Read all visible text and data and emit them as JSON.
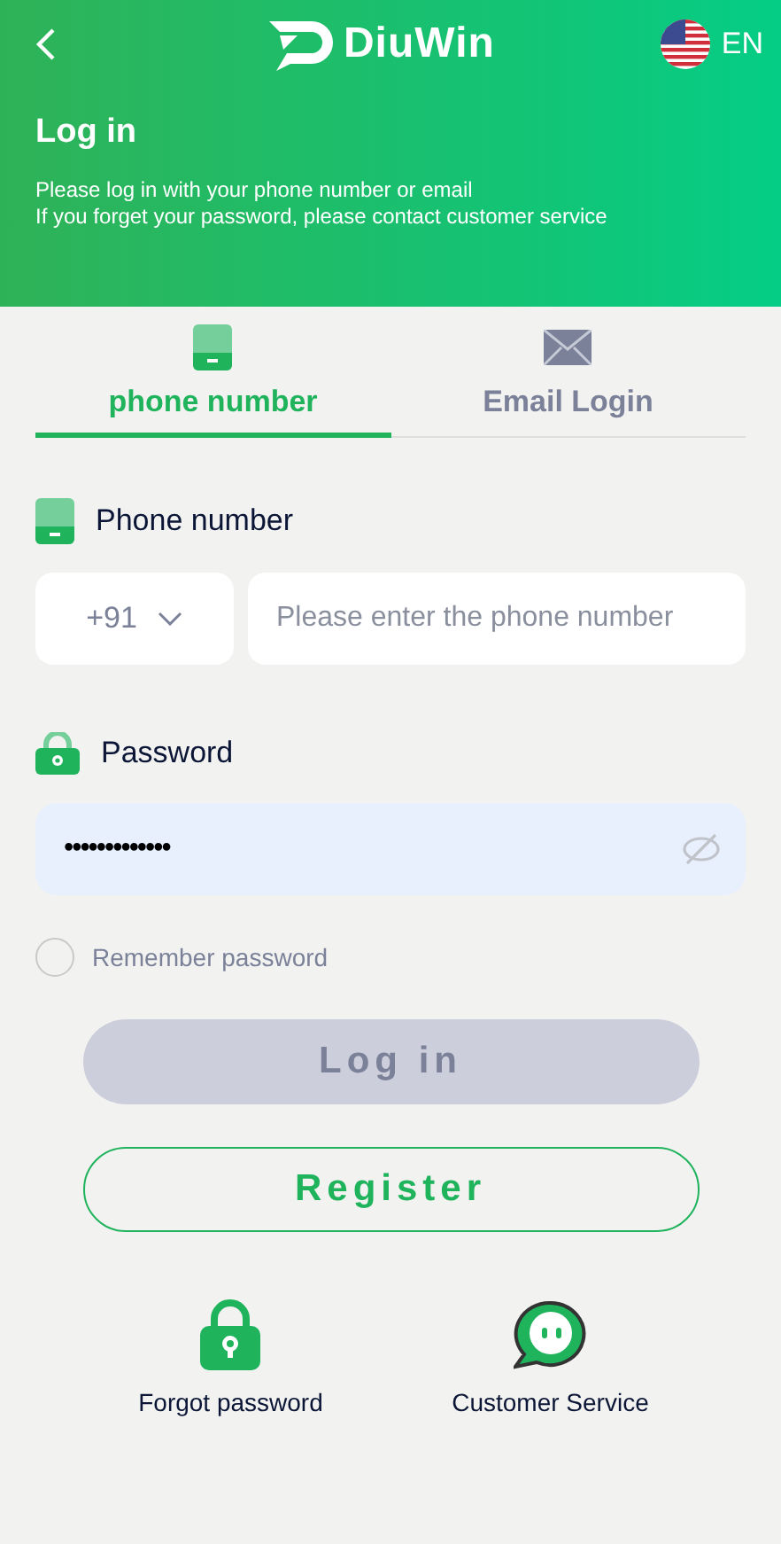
{
  "header": {
    "logo_text": "DiuWin",
    "language": "EN",
    "title": "Log in",
    "notes": [
      "Please log in with your phone number or email",
      "If you forget your password, please contact customer service"
    ]
  },
  "tabs": [
    {
      "label": "phone number",
      "kind": "phone",
      "selected": true
    },
    {
      "label": "Email Login",
      "kind": "email",
      "selected": false
    }
  ],
  "phone": {
    "label": "Phone number",
    "country_code": "+91",
    "placeholder": "Please enter the phone number"
  },
  "password": {
    "label": "Password",
    "value": "•••••••••••••"
  },
  "remember": {
    "label": "Remember password",
    "checked": false
  },
  "login_button": {
    "label": "Log in",
    "disabled": true
  },
  "register_button": {
    "label": "Register"
  },
  "links": [
    {
      "label": "Forgot password",
      "kind": "lock"
    },
    {
      "label": "Customer Service",
      "kind": "chat"
    }
  ]
}
